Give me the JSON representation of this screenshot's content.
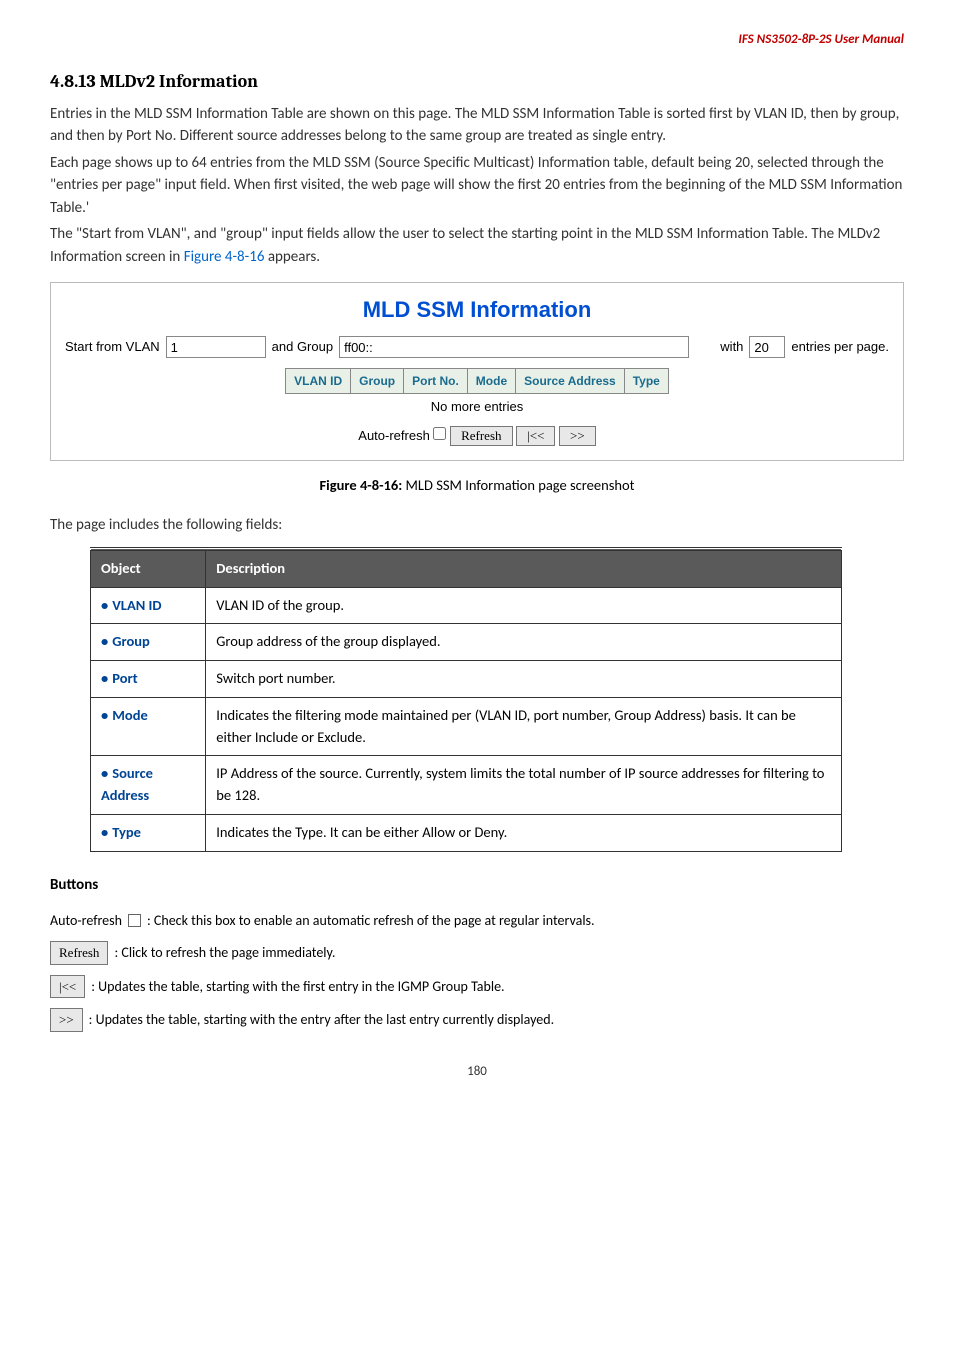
{
  "header": {
    "text": "IFS NS3502-8P-2S  User Manual"
  },
  "section": {
    "heading": "4.8.13 MLDv2 Information",
    "para1": "Entries in the MLD SSM Information Table are shown on this page. The MLD SSM Information Table is sorted first by VLAN ID, then by group, and then by Port No. Different source addresses belong to the same group are treated as single entry.",
    "para2": "Each page shows up to 64 entries from the MLD SSM (Source Specific Multicast) Information table, default being 20, selected through the \"entries per page\" input field. When first visited, the web page will show the first 20 entries from the beginning of the MLD SSM Information Table.'",
    "para3_a": "The \"Start from VLAN\", and \"group\" input fields allow the user to select the starting point in the MLD SSM Information Table.      The MLDv2 Information screen in ",
    "para3_link": "Figure 4-8-16",
    "para3_b": " appears."
  },
  "figure": {
    "title": "MLD SSM Information",
    "start_from_label": "Start from VLAN",
    "start_vlan_value": "1",
    "and_group_label": "and Group",
    "group_value": "ff00::",
    "with_label": "with",
    "entries_value": "20",
    "entries_per_page": "entries per page.",
    "cols": {
      "vlanid": "VLAN ID",
      "group": "Group",
      "portno": "Port No.",
      "mode": "Mode",
      "src": "Source Address",
      "type": "Type"
    },
    "no_more": "No more entries",
    "auto_refresh": "Auto-refresh",
    "refresh": "Refresh",
    "first": "|<<",
    "next": ">>"
  },
  "caption": {
    "prefix": "Figure 4-8-16: ",
    "text": "MLD SSM Information page screenshot"
  },
  "fields_intro": "The page includes the following fields:",
  "table": {
    "head_obj": "Object",
    "head_desc": "Description",
    "rows": [
      {
        "obj": "VLAN ID",
        "desc": "VLAN ID of the group."
      },
      {
        "obj": "Group",
        "desc": "Group address of the group displayed."
      },
      {
        "obj": "Port",
        "desc": "Switch port number."
      },
      {
        "obj": "Mode",
        "desc": "Indicates the filtering mode maintained per (VLAN ID, port number, Group Address) basis. It can be either Include or Exclude."
      },
      {
        "obj": "Source Address",
        "desc": "IP Address of the source. Currently, system limits the total number of IP source addresses for filtering to be 128."
      },
      {
        "obj": "Type",
        "desc": "Indicates the Type. It can be either Allow or Deny."
      }
    ]
  },
  "buttons": {
    "heading": "Buttons",
    "auto_refresh_prefix": "Auto-refresh",
    "auto_refresh_desc": ": Check this box to enable an automatic refresh of the page at regular intervals.",
    "refresh_label": "Refresh",
    "refresh_desc": ": Click to refresh the page immediately.",
    "first_label": "|<<",
    "first_desc": ": Updates the table, starting with the first entry in the IGMP Group Table.",
    "next_label": ">>",
    "next_desc": ": Updates the table, starting with the entry after the last entry currently displayed."
  },
  "page_num": "180"
}
